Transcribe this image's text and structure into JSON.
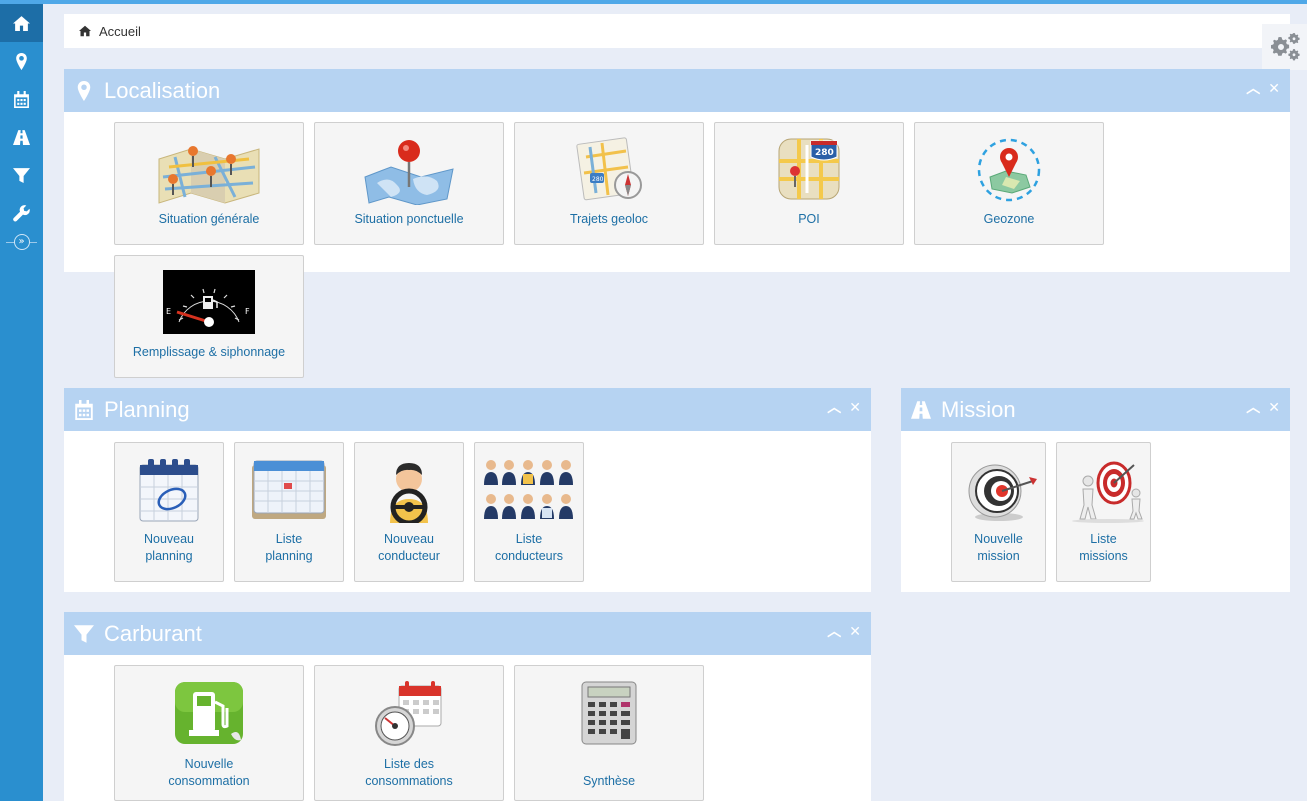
{
  "breadcrumb": {
    "home_label": "Accueil"
  },
  "sidebar": {
    "items": [
      {
        "icon": "home-icon"
      },
      {
        "icon": "map-marker-icon"
      },
      {
        "icon": "calendar-icon"
      },
      {
        "icon": "road-icon"
      },
      {
        "icon": "filter-icon"
      },
      {
        "icon": "wrench-icon"
      }
    ],
    "collapse_glyph": "»"
  },
  "panels": {
    "localisation": {
      "title": "Localisation",
      "tiles": [
        {
          "label": "Situation générale",
          "icon": "map-pins-icon"
        },
        {
          "label": "Situation ponctuelle",
          "icon": "world-map-pin-icon"
        },
        {
          "label": "Trajets geoloc",
          "icon": "map-compass-icon"
        },
        {
          "label": "POI",
          "icon": "poi-map-icon"
        },
        {
          "label": "Geozone",
          "icon": "geozone-icon"
        },
        {
          "label": "Remplissage & siphonnage",
          "icon": "fuel-gauge-icon"
        }
      ]
    },
    "planning": {
      "title": "Planning",
      "tiles": [
        {
          "label": "Nouveau\nplanning",
          "icon": "new-calendar-icon"
        },
        {
          "label": "Liste\nplanning",
          "icon": "calendar-list-icon"
        },
        {
          "label": "Nouveau\nconducteur",
          "icon": "driver-icon"
        },
        {
          "label": "Liste\nconducteurs",
          "icon": "drivers-group-icon"
        }
      ]
    },
    "mission": {
      "title": "Mission",
      "tiles": [
        {
          "label": "Nouvelle\nmission",
          "icon": "target-icon"
        },
        {
          "label": "Liste\nmissions",
          "icon": "target-people-icon"
        }
      ]
    },
    "carburant": {
      "title": "Carburant",
      "tiles": [
        {
          "label": "Nouvelle\nconsommation",
          "icon": "fuel-pump-icon"
        },
        {
          "label": "Liste des\nconsommations",
          "icon": "gauge-calendar-icon"
        },
        {
          "label": "Synthèse",
          "icon": "calculator-icon"
        }
      ]
    }
  },
  "colors": {
    "sidebar": "#2a8fcf",
    "panel_header": "#b6d3f2",
    "link": "#1d6fa5"
  }
}
